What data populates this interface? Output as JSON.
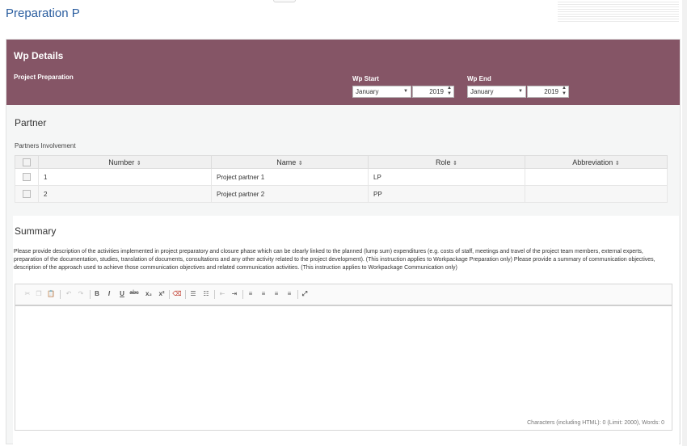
{
  "page_title": "Preparation P",
  "wp": {
    "title": "Wp Details",
    "subtitle": "Project Preparation",
    "start": {
      "label": "Wp Start",
      "month": "January",
      "year": "2019"
    },
    "end": {
      "label": "Wp End",
      "month": "January",
      "year": "2019"
    }
  },
  "partner": {
    "heading": "Partner",
    "table_caption": "Partners Involvement",
    "columns": [
      "Number",
      "Name",
      "Role",
      "Abbreviation"
    ],
    "rows": [
      {
        "number": "1",
        "name": "Project partner 1",
        "role": "LP",
        "abbreviation": ""
      },
      {
        "number": "2",
        "name": "Project partner 2",
        "role": "PP",
        "abbreviation": ""
      }
    ]
  },
  "summary": {
    "heading": "Summary",
    "description": "Please provide description of the activities implemented in project preparatory and closure phase which can be clearly linked to the planned (lump sum) expenditures (e.g. costs of staff, meetings and travel of the project team members, external experts, preparation of the documentation, studies, translation of documents, consultations and any other activity related to the project development). (This instruction applies to Workpackage Preparation only) Please provide a summary of communication objectives, description of the approach used to achieve those communication objectives and related communication activities. (This instruction applies to Workpackage Communication only)",
    "counter": "Characters (including HTML): 0 (Limit: 2000), Words: 0"
  },
  "colors": {
    "header_bg": "#855566",
    "title_blue": "#2a5d9f"
  }
}
